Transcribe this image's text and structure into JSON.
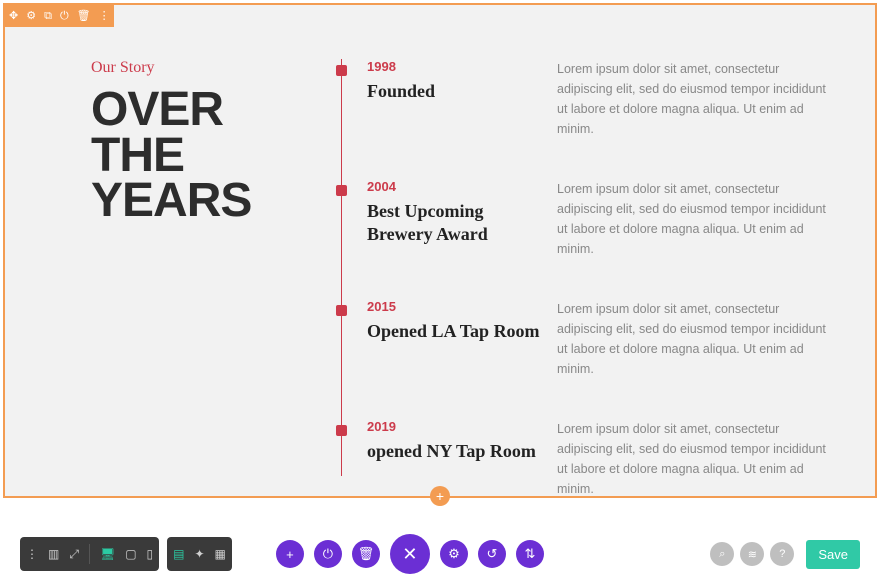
{
  "section_toolbar": {
    "icons": [
      "move-icon",
      "gear-icon",
      "duplicate-icon",
      "power-icon",
      "trash-icon",
      "more-icon"
    ]
  },
  "story": {
    "kicker": "Our Story",
    "headline": "OVER THE YEARS"
  },
  "timeline": [
    {
      "year": "1998",
      "title": "Founded",
      "desc": "Lorem ipsum dolor sit amet, consectetur adipiscing elit, sed do eiusmod tempor incididunt ut labore et dolore magna aliqua. Ut enim ad minim."
    },
    {
      "year": "2004",
      "title": "Best Upcoming Brewery Award",
      "desc": "Lorem ipsum dolor sit amet, consectetur adipiscing elit, sed do eiusmod tempor incididunt ut labore et dolore magna aliqua. Ut enim ad minim."
    },
    {
      "year": "2015",
      "title": "Opened LA Tap Room",
      "desc": "Lorem ipsum dolor sit amet, consectetur adipiscing elit, sed do eiusmod tempor incididunt ut labore et dolore magna aliqua. Ut enim ad minim."
    },
    {
      "year": "2019",
      "title": "opened NY Tap Room",
      "desc": "Lorem ipsum dolor sit amet, consectetur adipiscing elit, sed do eiusmod tempor incididunt ut labore et dolore magna aliqua. Ut enim ad minim."
    }
  ],
  "bottom": {
    "save_label": "Save"
  }
}
